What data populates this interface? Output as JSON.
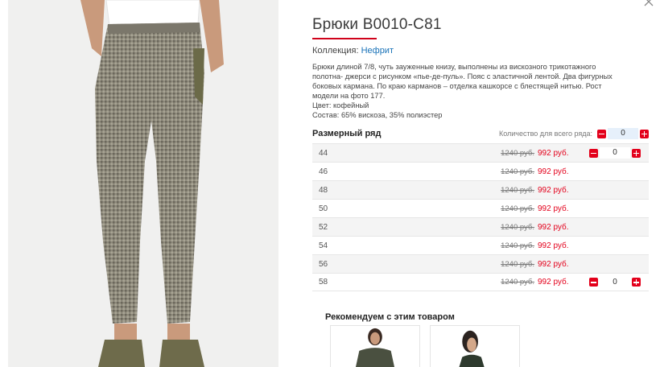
{
  "product": {
    "title": "Брюки В0010-С81",
    "collection_label": "Коллекция:",
    "collection_name": "Нефрит",
    "description": [
      "Брюки длиной 7/8, чуть зауженные книзу, выполнены из вискозного трикотажного",
      "полотна- джерси с рисунком «пье-де-пуль». Пояс с эластичной лентой. Два фигурных",
      "боковых кармана. По краю карманов – отделка кашкорсе с блестящей нитью. Рост",
      "модели на фото 177.",
      "Цвет: кофейный",
      "Состав: 65% вискоза, 35% полиэстер"
    ]
  },
  "sizes": {
    "title": "Размерный ряд",
    "qty_all_label": "Количество для всего ряда:",
    "qty_all_value": "0",
    "rows": [
      {
        "size": "44",
        "old_price": "1240 руб.",
        "new_price": "992 руб.",
        "qty": "0",
        "stepper": true
      },
      {
        "size": "46",
        "old_price": "1240 руб.",
        "new_price": "992 руб.",
        "qty": "",
        "stepper": false
      },
      {
        "size": "48",
        "old_price": "1240 руб.",
        "new_price": "992 руб.",
        "qty": "",
        "stepper": false
      },
      {
        "size": "50",
        "old_price": "1240 руб.",
        "new_price": "992 руб.",
        "qty": "",
        "stepper": false
      },
      {
        "size": "52",
        "old_price": "1240 руб.",
        "new_price": "992 руб.",
        "qty": "",
        "stepper": false
      },
      {
        "size": "54",
        "old_price": "1240 руб.",
        "new_price": "992 руб.",
        "qty": "",
        "stepper": false
      },
      {
        "size": "56",
        "old_price": "1240 руб.",
        "new_price": "992 руб.",
        "qty": "",
        "stepper": false
      },
      {
        "size": "58",
        "old_price": "1240 руб.",
        "new_price": "992 руб.",
        "qty": "0",
        "stepper": true
      }
    ]
  },
  "recommend": {
    "title": "Рекомендуем с этим товаром"
  },
  "icons": {
    "close": "close-icon",
    "minus": "minus-icon",
    "plus": "plus-icon"
  },
  "colors": {
    "accent": "#e3001b",
    "link": "#1a73b8",
    "underline": "#d0021b"
  }
}
